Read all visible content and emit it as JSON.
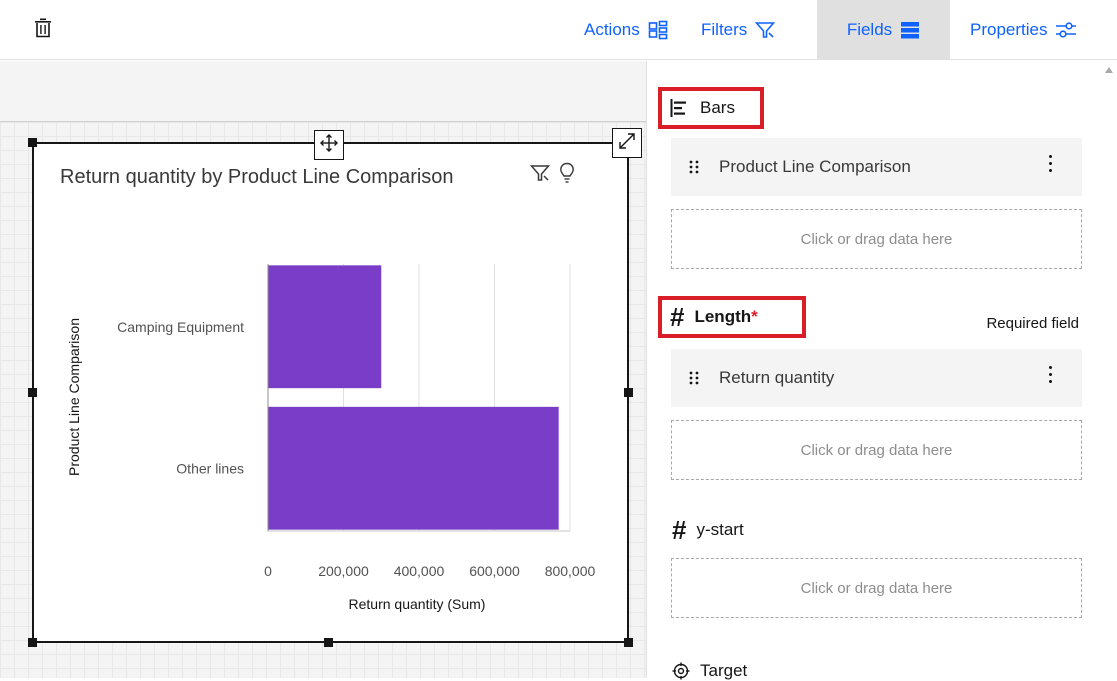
{
  "toolbar": {
    "tabs": {
      "actions": "Actions",
      "filters": "Filters",
      "fields": "Fields",
      "properties": "Properties"
    },
    "active_tab": "fields",
    "accent_color": "#0f62fe"
  },
  "widget": {
    "title": "Return quantity by Product Line Comparison"
  },
  "chart_data": {
    "type": "bar",
    "orientation": "horizontal",
    "categories": [
      "Camping Equipment",
      "Other lines"
    ],
    "values": [
      300000,
      770000
    ],
    "ylabel": "Product Line Comparison",
    "xlabel": "Return quantity (Sum)",
    "x_ticks": [
      "0",
      "200,000",
      "400,000",
      "600,000",
      "800,000"
    ],
    "xlim": [
      0,
      800000
    ],
    "grid": true,
    "bar_color": "#7a3dc8"
  },
  "panel": {
    "bars": {
      "heading": "Bars",
      "field": "Product Line Comparison",
      "drop_label": "Click or drag data here"
    },
    "length": {
      "heading": "Length",
      "required_marker": "*",
      "required_note": "Required field",
      "field": "Return quantity",
      "drop_label": "Click or drag data here"
    },
    "ystart": {
      "heading": "y-start",
      "drop_label": "Click or drag data here"
    },
    "target": {
      "heading": "Target"
    },
    "highlight_color": "#da1e28"
  }
}
